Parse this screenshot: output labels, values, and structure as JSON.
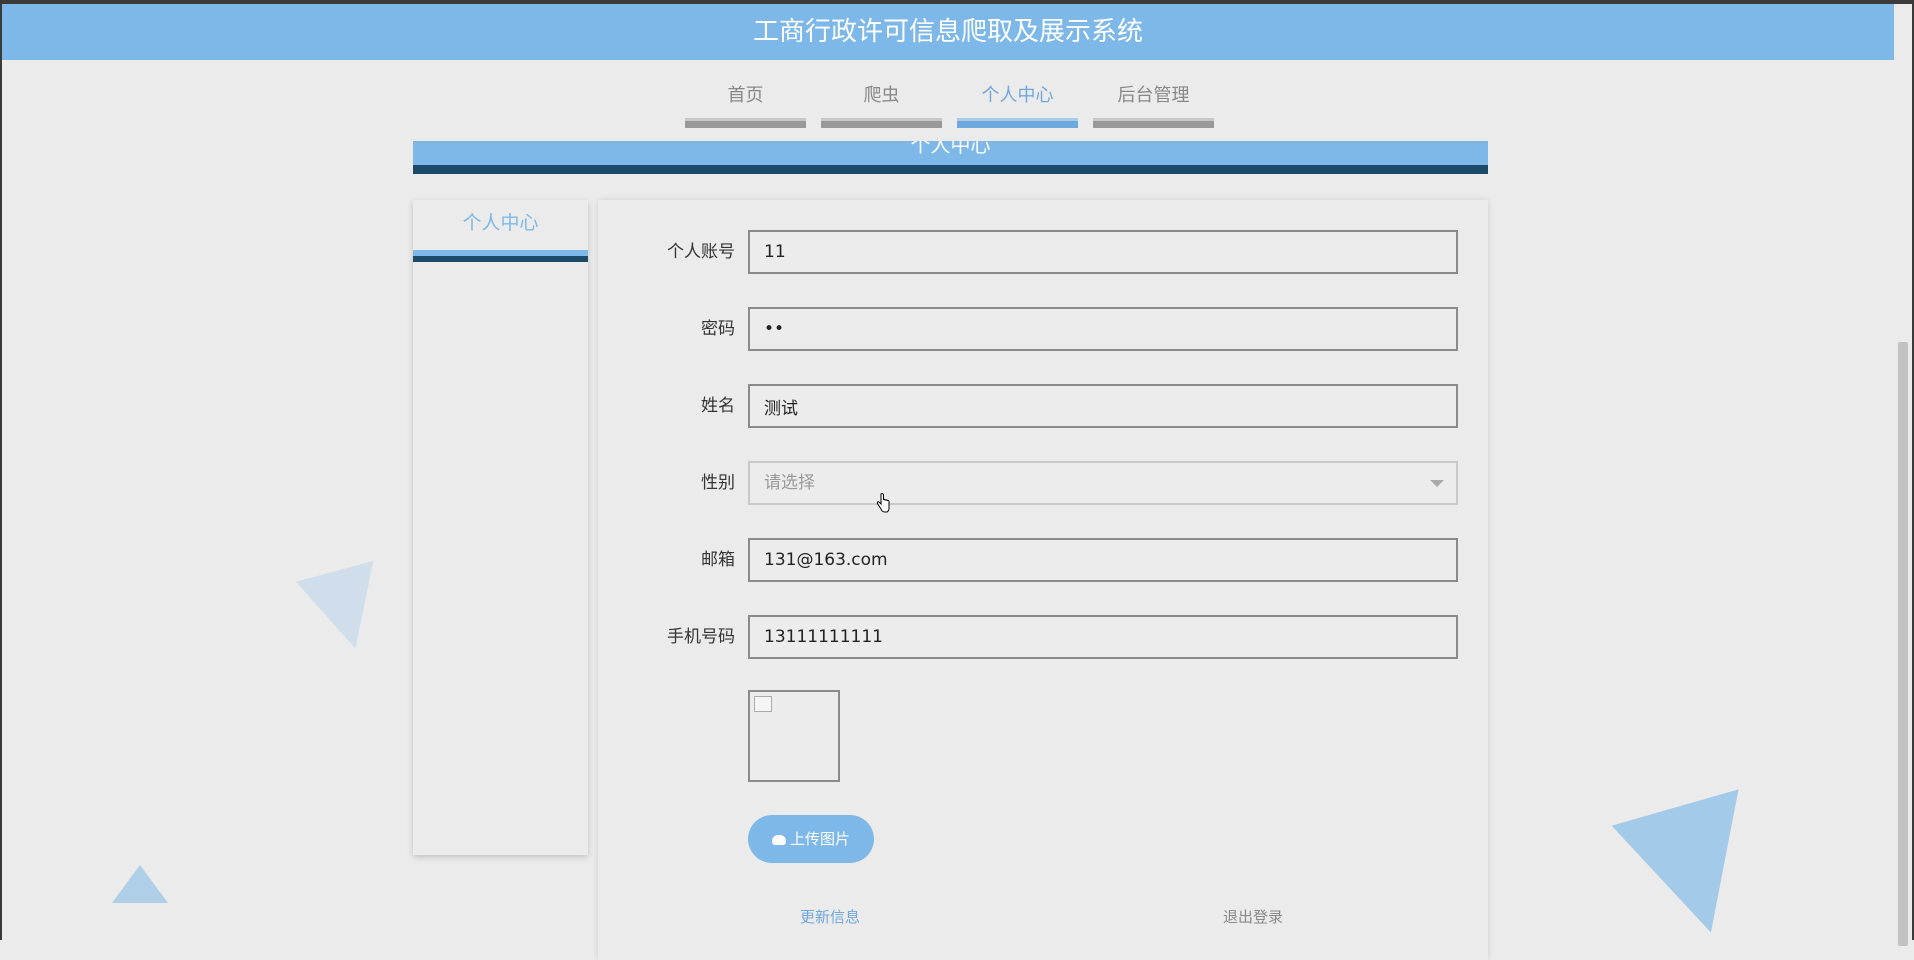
{
  "app": {
    "title": "工商行政许可信息爬取及展示系统"
  },
  "nav": {
    "items": [
      {
        "label": "首页"
      },
      {
        "label": "爬虫"
      },
      {
        "label": "个人中心"
      },
      {
        "label": "后台管理"
      }
    ]
  },
  "page": {
    "banner_title": "个人中心"
  },
  "sidebar": {
    "items": [
      {
        "label": "个人中心"
      }
    ]
  },
  "form": {
    "account_label": "个人账号",
    "account_value": "11",
    "password_label": "密码",
    "password_value": "••",
    "name_label": "姓名",
    "name_value": "测试",
    "gender_label": "性别",
    "gender_placeholder": "请选择",
    "email_label": "邮箱",
    "email_value": "131@163.com",
    "phone_label": "手机号码",
    "phone_value": "13111111111",
    "upload_label": "上传图片",
    "update_label": "更新信息",
    "logout_label": "退出登录"
  },
  "colors": {
    "accent": "#7db8e8",
    "accent_dark": "#1e4a6a",
    "background": "#ebebeb"
  }
}
